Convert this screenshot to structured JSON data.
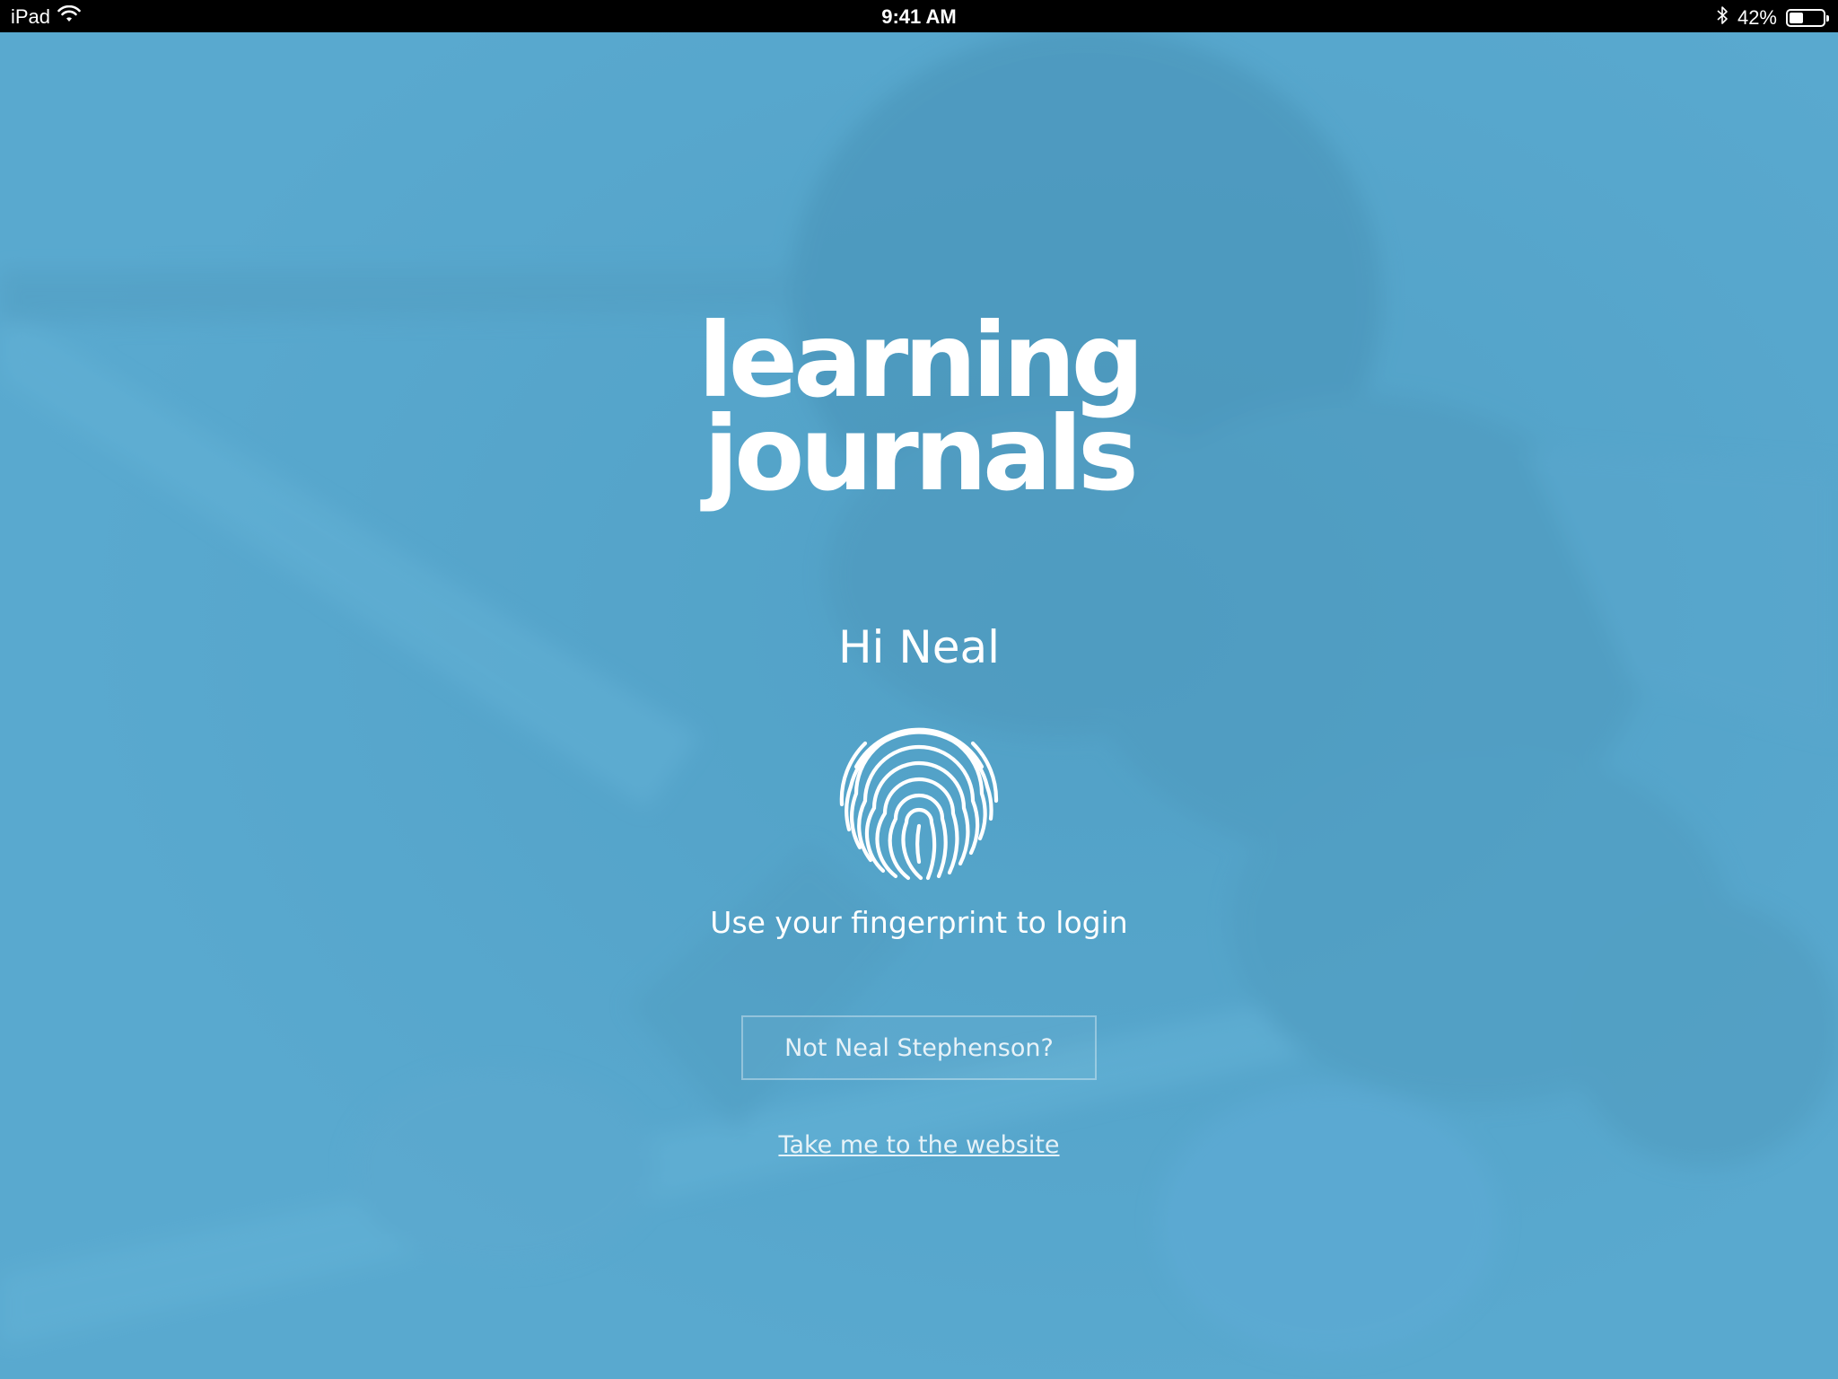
{
  "status_bar": {
    "device": "iPad",
    "time": "9:41 AM",
    "battery_percent_label": "42%",
    "battery_level": 0.42,
    "icons": [
      "wifi-icon",
      "bluetooth-icon",
      "battery-icon"
    ]
  },
  "logo": {
    "line1": "learning",
    "line2": "journals"
  },
  "greeting": "Hi Neal",
  "fingerprint_icon": "fingerprint-icon",
  "instruction": "Use your fingerprint to login",
  "not_user_button": "Not Neal Stephenson?",
  "website_link": "Take me to the website",
  "colors": {
    "overlay": "#58a9cf",
    "text": "#ffffff",
    "status_bar": "#000000"
  }
}
